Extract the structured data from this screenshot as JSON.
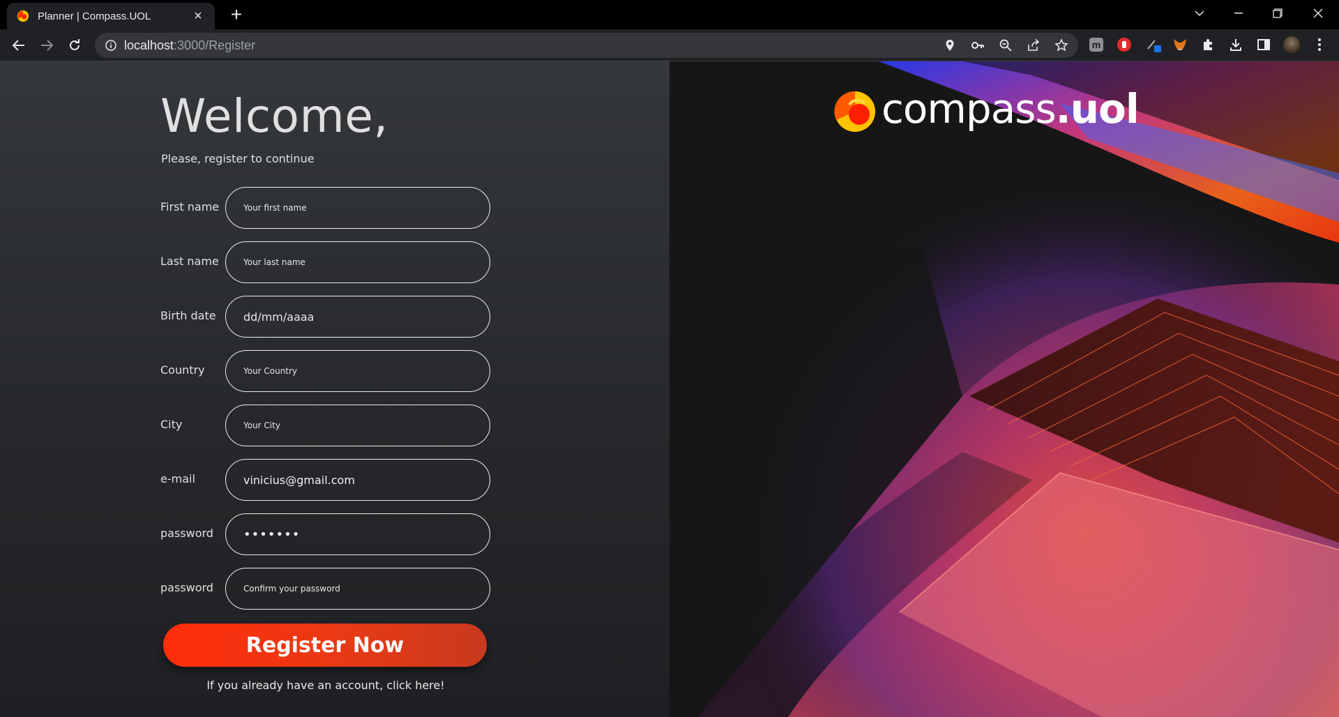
{
  "browser": {
    "tab_title": "Planner | Compass.UOL",
    "url_host": "localhost",
    "url_path": ":3000/Register"
  },
  "page": {
    "welcome": "Welcome,",
    "subtitle": "Please, register to continue",
    "fields": [
      {
        "label": "First name",
        "placeholder": "Your first name",
        "value": ""
      },
      {
        "label": "Last name",
        "placeholder": "Your last name",
        "value": ""
      },
      {
        "label": "Birth date",
        "placeholder": "dd/mm/aaaa",
        "value": ""
      },
      {
        "label": "Country",
        "placeholder": "Your Country",
        "value": ""
      },
      {
        "label": "City",
        "placeholder": "Your City",
        "value": ""
      },
      {
        "label": "e-mail",
        "placeholder": "",
        "value": "vinicius@gmail.com"
      },
      {
        "label": "password",
        "placeholder": "",
        "value": "•••••••"
      },
      {
        "label": "password",
        "placeholder": "Confirm your password",
        "value": ""
      }
    ],
    "register_button": "Register Now",
    "login_link": "If you already have an account, click here!"
  },
  "logo": {
    "word": "compass",
    "suffix": ".uol"
  },
  "colors": {
    "accent": "#ff2d0a",
    "accent_end": "#c7391e",
    "logo_yellow": "#ffc400",
    "logo_red": "#ff1e00"
  },
  "icons": [
    "back-arrow-icon",
    "forward-arrow-icon",
    "reload-icon",
    "info-icon",
    "location-icon",
    "key-icon",
    "zoom-icon",
    "share-icon",
    "star-icon",
    "extensions-icon",
    "download-icon",
    "sidepanel-icon",
    "menu-icon"
  ]
}
